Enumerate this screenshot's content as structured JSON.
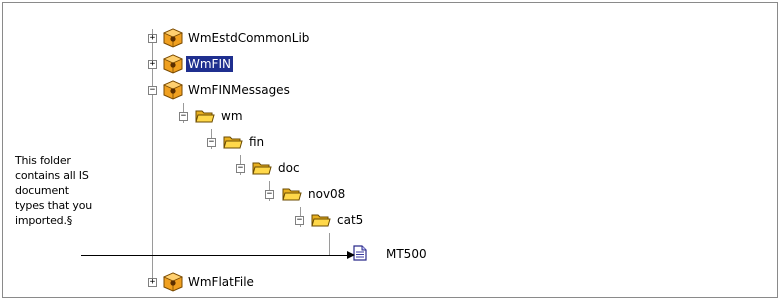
{
  "tree": {
    "nodes": [
      {
        "id": "WmEstdCommonLib",
        "label": "WmEstdCommonLib",
        "type": "package",
        "expander": "+",
        "selected": false
      },
      {
        "id": "WmFIN",
        "label": "WmFIN",
        "type": "package",
        "expander": "+",
        "selected": true
      },
      {
        "id": "WmFINMessages",
        "label": "WmFINMessages",
        "type": "package",
        "expander": "−",
        "selected": false
      },
      {
        "id": "wm",
        "label": "wm",
        "type": "folder",
        "expander": "−",
        "selected": false
      },
      {
        "id": "fin",
        "label": "fin",
        "type": "folder",
        "expander": "−",
        "selected": false
      },
      {
        "id": "doc",
        "label": "doc",
        "type": "folder",
        "expander": "−",
        "selected": false
      },
      {
        "id": "nov08",
        "label": "nov08",
        "type": "folder",
        "expander": "−",
        "selected": false
      },
      {
        "id": "cat5",
        "label": "cat5",
        "type": "folder",
        "expander": "−",
        "selected": false
      },
      {
        "id": "MT500",
        "label": "MT500",
        "type": "document",
        "expander": "",
        "selected": false
      },
      {
        "id": "WmFlatFile",
        "label": "WmFlatFile",
        "type": "package",
        "expander": "+",
        "selected": false
      }
    ]
  },
  "annotation": {
    "lines": [
      "This folder",
      "contains all IS",
      "document",
      "types that you",
      "imported.§"
    ]
  },
  "colors": {
    "selection_bg": "#1f2f8f",
    "package_orange": "#f0a020",
    "folder_yellow": "#f3c623",
    "document_blue": "#3a3aa0"
  },
  "icons": {
    "package": "package-icon",
    "folder": "folder-icon",
    "document": "document-icon"
  }
}
